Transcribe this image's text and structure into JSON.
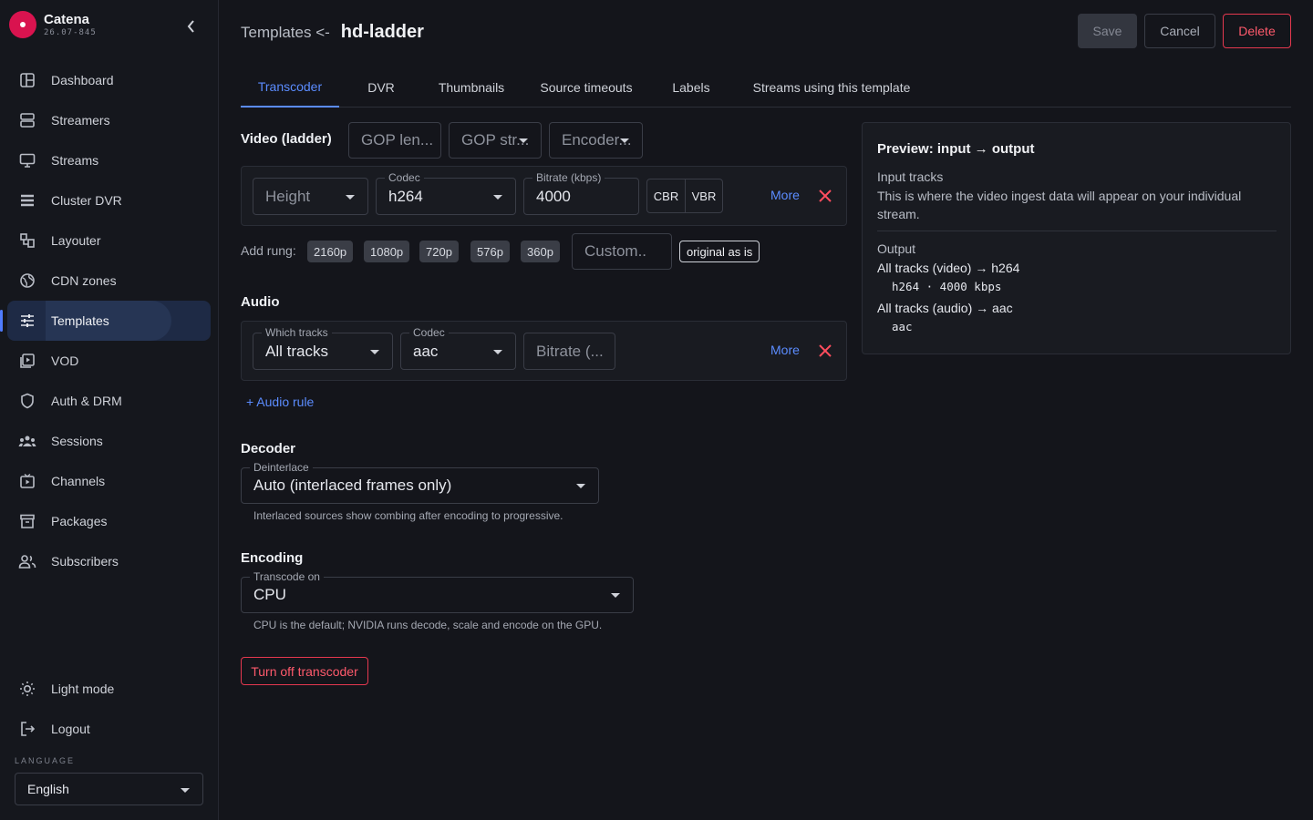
{
  "brand": {
    "name": "Catena",
    "version": "26.07-845"
  },
  "sidebar": {
    "items": [
      {
        "label": "Dashboard",
        "icon": "dashboard-icon"
      },
      {
        "label": "Streamers",
        "icon": "server-icon"
      },
      {
        "label": "Streams",
        "icon": "monitor-icon"
      },
      {
        "label": "Cluster DVR",
        "icon": "list-icon"
      },
      {
        "label": "Layouter",
        "icon": "layout-icon"
      },
      {
        "label": "CDN zones",
        "icon": "globe-icon"
      },
      {
        "label": "Templates",
        "icon": "sliders-icon",
        "active": true
      },
      {
        "label": "VOD",
        "icon": "video-library-icon"
      },
      {
        "label": "Auth & DRM",
        "icon": "shield-icon"
      },
      {
        "label": "Sessions",
        "icon": "group-icon"
      },
      {
        "label": "Channels",
        "icon": "tv-icon"
      },
      {
        "label": "Packages",
        "icon": "archive-icon"
      },
      {
        "label": "Subscribers",
        "icon": "users-icon"
      }
    ],
    "bottom": [
      {
        "label": "Light mode",
        "icon": "sun-icon"
      },
      {
        "label": "Logout",
        "icon": "logout-icon"
      }
    ],
    "language_label": "LANGUAGE",
    "language_value": "English"
  },
  "header": {
    "breadcrumb_parent": "Templates <-",
    "title": "hd-ladder",
    "save": "Save",
    "cancel": "Cancel",
    "delete": "Delete"
  },
  "tabs": [
    "Transcoder",
    "DVR",
    "Thumbnails",
    "Source timeouts",
    "Labels",
    "Streams using this template"
  ],
  "video": {
    "title": "Video (ladder)",
    "gop_length_placeholder": "GOP len...",
    "gop_structure_placeholder": "GOP str...",
    "encoder_placeholder": "Encoder...",
    "rung": {
      "height_placeholder": "Height",
      "codec_label": "Codec",
      "codec_value": "h264",
      "bitrate_label": "Bitrate (kbps)",
      "bitrate_value": "4000",
      "cbr": "CBR",
      "vbr": "VBR",
      "more": "More"
    },
    "add_rung_label": "Add rung:",
    "rungs": [
      "2160p",
      "1080p",
      "720p",
      "576p",
      "360p"
    ],
    "custom_placeholder": "Custom..",
    "original": "original as is"
  },
  "audio": {
    "title": "Audio",
    "tracks_label": "Which tracks",
    "tracks_value": "All tracks",
    "codec_label": "Codec",
    "codec_value": "aac",
    "bitrate_placeholder": "Bitrate (...",
    "more": "More",
    "add_rule": "+ Audio rule"
  },
  "decoder": {
    "title": "Decoder",
    "deinterlace_label": "Deinterlace",
    "deinterlace_value": "Auto (interlaced frames only)",
    "helper": "Interlaced sources show combing after encoding to progressive."
  },
  "encoding": {
    "title": "Encoding",
    "transcode_label": "Transcode on",
    "transcode_value": "CPU",
    "helper": "CPU is the default; NVIDIA runs decode, scale and encode on the GPU."
  },
  "turn_off": "Turn off transcoder",
  "preview": {
    "title": "Preview: input → output",
    "input_title": "Input tracks",
    "input_text": "This is where the video ingest data will appear on your individual stream.",
    "output_title": "Output",
    "video_line": "All tracks (video) → h264",
    "video_detail": "h264 · 4000 kbps",
    "audio_line": "All tracks (audio) → aac",
    "audio_detail": "aac"
  },
  "colors": {
    "accent": "#5b8cff",
    "danger": "#ff5a6c",
    "brand": "#d9134f",
    "background": "#14151b"
  }
}
